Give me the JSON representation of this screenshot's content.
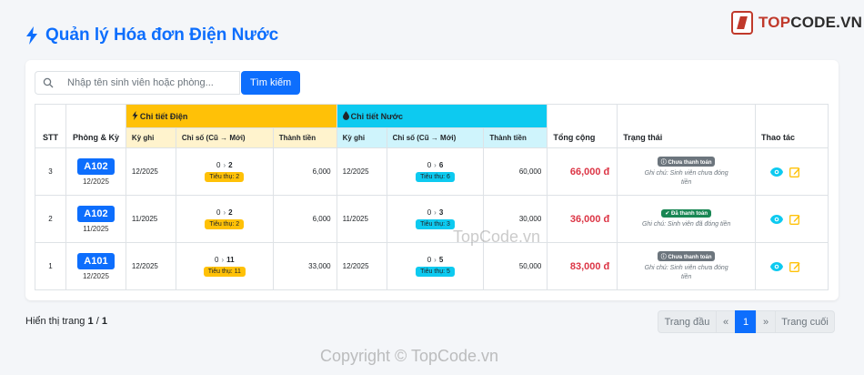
{
  "page": {
    "title": "Quản lý Hóa đơn Điện Nước"
  },
  "logo": {
    "prefix": "TOP",
    "suffix": "CODE.VN"
  },
  "search": {
    "placeholder": "Nhập tên sinh viên hoặc phòng...",
    "button_label": "Tìm kiếm"
  },
  "table": {
    "headers": {
      "stt": "STT",
      "room_period": "Phòng & Kỳ",
      "electric_group": "Chi tiết Điện",
      "water_group": "Chi tiết Nước",
      "total": "Tổng cộng",
      "status": "Trạng thái",
      "actions": "Thao tác",
      "period": "Kỳ ghi",
      "reading_old": "Chỉ số (Cũ",
      "reading_new": "Mới)",
      "amount": "Thành tiền"
    },
    "rows": [
      {
        "stt": "3",
        "room": "A102",
        "period": "12/2025",
        "elec_period": "12/2025",
        "elec_old": "0",
        "elec_new": "2",
        "elec_usage": "Tiêu thụ: 2",
        "elec_amount": "6,000",
        "water_period": "12/2025",
        "water_old": "0",
        "water_new": "6",
        "water_usage": "Tiêu thụ: 6",
        "water_amount": "60,000",
        "total": "66,000 đ",
        "status": "Chưa thanh toán",
        "status_type": "unpaid",
        "note": "Ghi chú: Sinh viên chưa đóng tiền"
      },
      {
        "stt": "2",
        "room": "A102",
        "period": "11/2025",
        "elec_period": "11/2025",
        "elec_old": "0",
        "elec_new": "2",
        "elec_usage": "Tiêu thụ: 2",
        "elec_amount": "6,000",
        "water_period": "11/2025",
        "water_old": "0",
        "water_new": "3",
        "water_usage": "Tiêu thụ: 3",
        "water_amount": "30,000",
        "total": "36,000 đ",
        "status": "Đã thanh toán",
        "status_type": "paid",
        "note": "Ghi chú: Sinh viên đã đóng tiền"
      },
      {
        "stt": "1",
        "room": "A101",
        "period": "12/2025",
        "elec_period": "12/2025",
        "elec_old": "0",
        "elec_new": "11",
        "elec_usage": "Tiêu thụ: 11",
        "elec_amount": "33,000",
        "water_period": "12/2025",
        "water_old": "0",
        "water_new": "5",
        "water_usage": "Tiêu thụ: 5",
        "water_amount": "50,000",
        "total": "83,000 đ",
        "status": "Chưa thanh toán",
        "status_type": "unpaid",
        "note": "Ghi chú: Sinh viên chưa đóng tiền"
      }
    ]
  },
  "footer": {
    "page_info_prefix": "Hiển thị trang",
    "page_current": "1",
    "page_sep": "/",
    "page_total": "1"
  },
  "pagination": {
    "first": "Trang đầu",
    "prev": "«",
    "current": "1",
    "next": "»",
    "last": "Trang cuối"
  },
  "watermarks": {
    "center": "TopCode.vn",
    "bottom": "Copyright © TopCode.vn"
  },
  "colors": {
    "primary": "#0d6efd",
    "electric": "#ffc107",
    "water": "#0dcaf0",
    "total": "#dc3545",
    "paid": "#198754",
    "unpaid": "#6c757d"
  }
}
